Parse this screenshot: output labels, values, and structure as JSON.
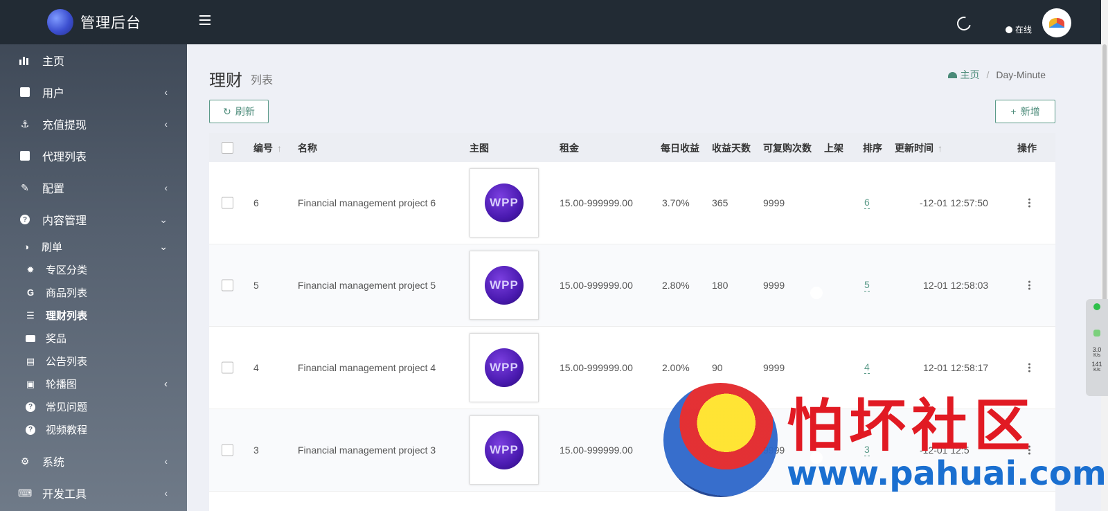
{
  "brand": {
    "title": "管理后台"
  },
  "topbar": {
    "status": "在线"
  },
  "sidebar": {
    "items": [
      {
        "label": "主页",
        "icon": "bar-chart-icon"
      },
      {
        "label": "用户",
        "icon": "user-card-icon"
      },
      {
        "label": "充值提现",
        "icon": "anchor-icon"
      },
      {
        "label": "代理列表",
        "icon": "user-card-icon"
      },
      {
        "label": "配置",
        "icon": "wrench-icon"
      },
      {
        "label": "内容管理",
        "icon": "question-circle-icon"
      }
    ],
    "content_sub": [
      {
        "label": "刷单",
        "icon": "half-circle-icon"
      }
    ],
    "brush_sub": [
      {
        "label": "专区分类",
        "icon": "gear-icon"
      },
      {
        "label": "商品列表",
        "icon": "g-icon"
      },
      {
        "label": "理财列表",
        "icon": "list-icon"
      },
      {
        "label": "奖品",
        "icon": "money-icon"
      },
      {
        "label": "公告列表",
        "icon": "file-icon"
      },
      {
        "label": "轮播图",
        "icon": "image-icon"
      },
      {
        "label": "常见问题",
        "icon": "question-circle-icon"
      },
      {
        "label": "视频教程",
        "icon": "question-circle-icon"
      }
    ],
    "bottom": [
      {
        "label": "系统",
        "icon": "gear-icon"
      },
      {
        "label": "开发工具",
        "icon": "keyboard-icon"
      }
    ]
  },
  "page": {
    "title": "理财",
    "subtitle": "列表",
    "breadcrumb": {
      "home": "主页",
      "current": "Day-Minute"
    },
    "refresh_label": "刷新",
    "add_label": "新增"
  },
  "table": {
    "headers": [
      "编号",
      "名称",
      "主图",
      "租金",
      "每日收益",
      "收益天数",
      "可复购次数",
      "上架",
      "排序",
      "更新时间",
      "操作"
    ],
    "rows": [
      {
        "id": "6",
        "name": "Financial management project 6",
        "thumb": "WPP",
        "rent": "15.00-999999.00",
        "daily": "3.70%",
        "days": "365",
        "rebuy": "9999",
        "sort": "6",
        "updated": "-12-01 12:57:50"
      },
      {
        "id": "5",
        "name": "Financial management project 5",
        "thumb": "WPP",
        "rent": "15.00-999999.00",
        "daily": "2.80%",
        "days": "180",
        "rebuy": "9999",
        "sort": "5",
        "updated": "12-01 12:58:03"
      },
      {
        "id": "4",
        "name": "Financial management project 4",
        "thumb": "WPP",
        "rent": "15.00-999999.00",
        "daily": "2.00%",
        "days": "90",
        "rebuy": "9999",
        "sort": "4",
        "updated": "12-01 12:58:17"
      },
      {
        "id": "3",
        "name": "Financial management project 3",
        "thumb": "WPP",
        "rent": "15.00-999999.00",
        "daily": "",
        "days": "",
        "rebuy": "9999",
        "sort": "3",
        "updated": "-12-01 12:5"
      }
    ]
  },
  "net_widget": {
    "up": "3.0",
    "up_unit": "K/s",
    "down": "141",
    "down_unit": "K/s"
  },
  "watermark": {
    "text": "怕坏社区",
    "url": "www.pahuai.com"
  },
  "colors": {
    "accent": "#4a8a78",
    "sidebar_top": "#3a4452",
    "topbar": "#222b34"
  }
}
